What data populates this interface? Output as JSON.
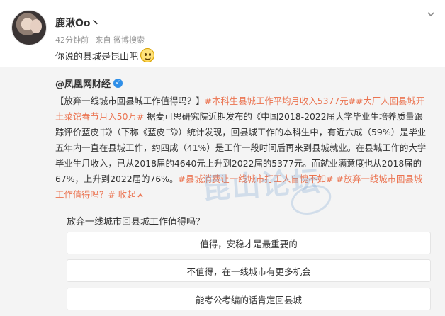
{
  "post": {
    "username": "鹿湫Oo丶",
    "time": "42分钟前",
    "source": "来自 微博搜索",
    "text": "你说的县城是昆山吧"
  },
  "repost": {
    "source_name": "@凤凰网财经",
    "body": {
      "seg1": "【放弃一线城市回县城工作值得吗？】",
      "tag1": "#本科生县城工作平均月收入5377元#",
      "tag2": "#大厂人回县城开土菜馆春节月入50万#",
      "seg2": " 据麦可思研究院近期发布的《中国2018-2022届大学毕业生培养质量跟踪评价蓝皮书》（下称《蓝皮书》）统计发现，回县城工作的本科生中，有近六成（59%）是毕业五年内一直在县城工作，约四成（41%）是工作一段时间后再来到县城就业。在县城工作的大学毕业生月收入，已从2018届的4640元上升到2022届的5377元。而就业满意度也从2018届的67%，上升到2022届的76%。",
      "tag3": "#县城消费让一线城市打工人自愧不如#",
      "tag4": " #放弃一线城市回县城工作值得吗？#",
      "collapse": " 收起"
    },
    "watermark": "昆山论坛",
    "poll": {
      "question": "放弃一线城市回县城工作值得吗？",
      "options": [
        "值得，安稳才是最重要的",
        "不值得，在一线城市有更多机会",
        "能考公考编的话肯定回县城"
      ]
    }
  },
  "colors": {
    "accent": "#eb7350",
    "verified": "#2f8fe8"
  }
}
